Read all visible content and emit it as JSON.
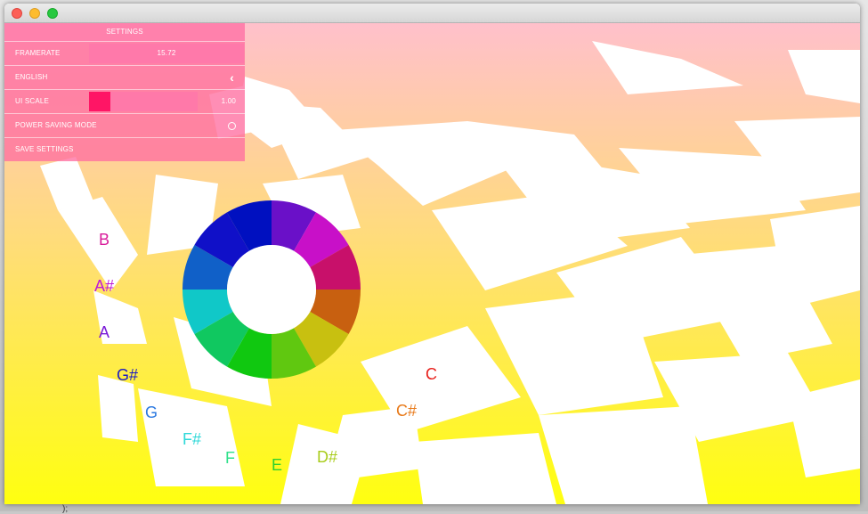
{
  "settings": {
    "title": "SETTINGS",
    "framerate_label": "FRAMERATE",
    "framerate_value": "15.72",
    "language_label": "ENGLISH",
    "language_chevron": "‹",
    "ui_scale_label": "UI SCALE",
    "ui_scale_value": "1.00",
    "ui_scale_fraction": 0.2,
    "power_saving_label": "POWER SAVING MODE",
    "power_saving_enabled": false,
    "save_label": "SAVE SETTINGS"
  },
  "notes": [
    {
      "name": "note-c",
      "label": "C",
      "color": "#e8201b"
    },
    {
      "name": "note-c-sharp",
      "label": "C#",
      "color": "#e87a1a"
    },
    {
      "name": "note-d-sharp",
      "label": "D#",
      "color": "#a8cc1a"
    },
    {
      "name": "note-e",
      "label": "E",
      "color": "#2ed12e"
    },
    {
      "name": "note-f",
      "label": "F",
      "color": "#2de08a"
    },
    {
      "name": "note-f-sharp",
      "label": "F#",
      "color": "#2ed8d8"
    },
    {
      "name": "note-g",
      "label": "G",
      "color": "#2a78e0"
    },
    {
      "name": "note-g-sharp",
      "label": "G#",
      "color": "#1a1ac4"
    },
    {
      "name": "note-a",
      "label": "A",
      "color": "#7a1ad8"
    },
    {
      "name": "note-a-sharp",
      "label": "A#",
      "color": "#c01ad8"
    },
    {
      "name": "note-b",
      "label": "B",
      "color": "#d81a9a"
    }
  ],
  "wheel_colors": [
    "#6a10c8",
    "#c810c8",
    "#c8106a",
    "#c86010",
    "#c8c010",
    "#60c810",
    "#10c810",
    "#10c860",
    "#10c8c8",
    "#1060c8",
    "#1010c8",
    "#0010c0"
  ],
  "bottom_text": ");"
}
